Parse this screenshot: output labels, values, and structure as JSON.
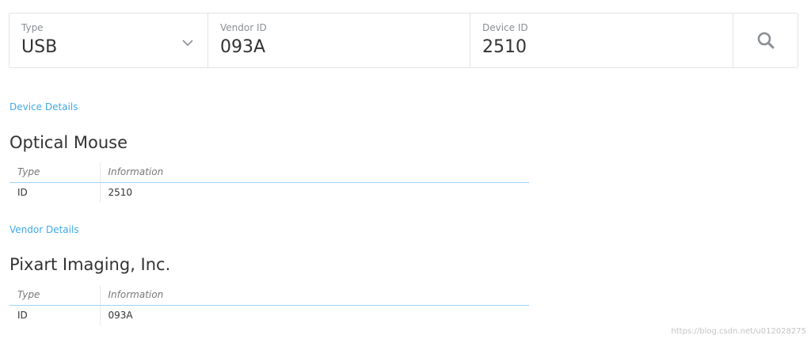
{
  "search": {
    "type": {
      "label": "Type",
      "value": "USB"
    },
    "vendor_id": {
      "label": "Vendor ID",
      "value": "093A"
    },
    "device_id": {
      "label": "Device ID",
      "value": "2510"
    },
    "icons": {
      "dropdown": "chevron-down-icon",
      "search": "search-icon"
    }
  },
  "device": {
    "section_link": "Device Details",
    "title": "Optical Mouse",
    "columns": [
      "Type",
      "Information"
    ],
    "rows": [
      {
        "type": "ID",
        "info": "2510"
      }
    ]
  },
  "vendor": {
    "section_link": "Vendor Details",
    "title": "Pixart Imaging, Inc.",
    "columns": [
      "Type",
      "Information"
    ],
    "rows": [
      {
        "type": "ID",
        "info": "093A"
      }
    ]
  },
  "watermark": "https://blog.csdn.net/u012028275",
  "colors": {
    "link": "#3fa9e8",
    "table_rule": "#9fd3f4",
    "border": "#e3e3e3"
  }
}
